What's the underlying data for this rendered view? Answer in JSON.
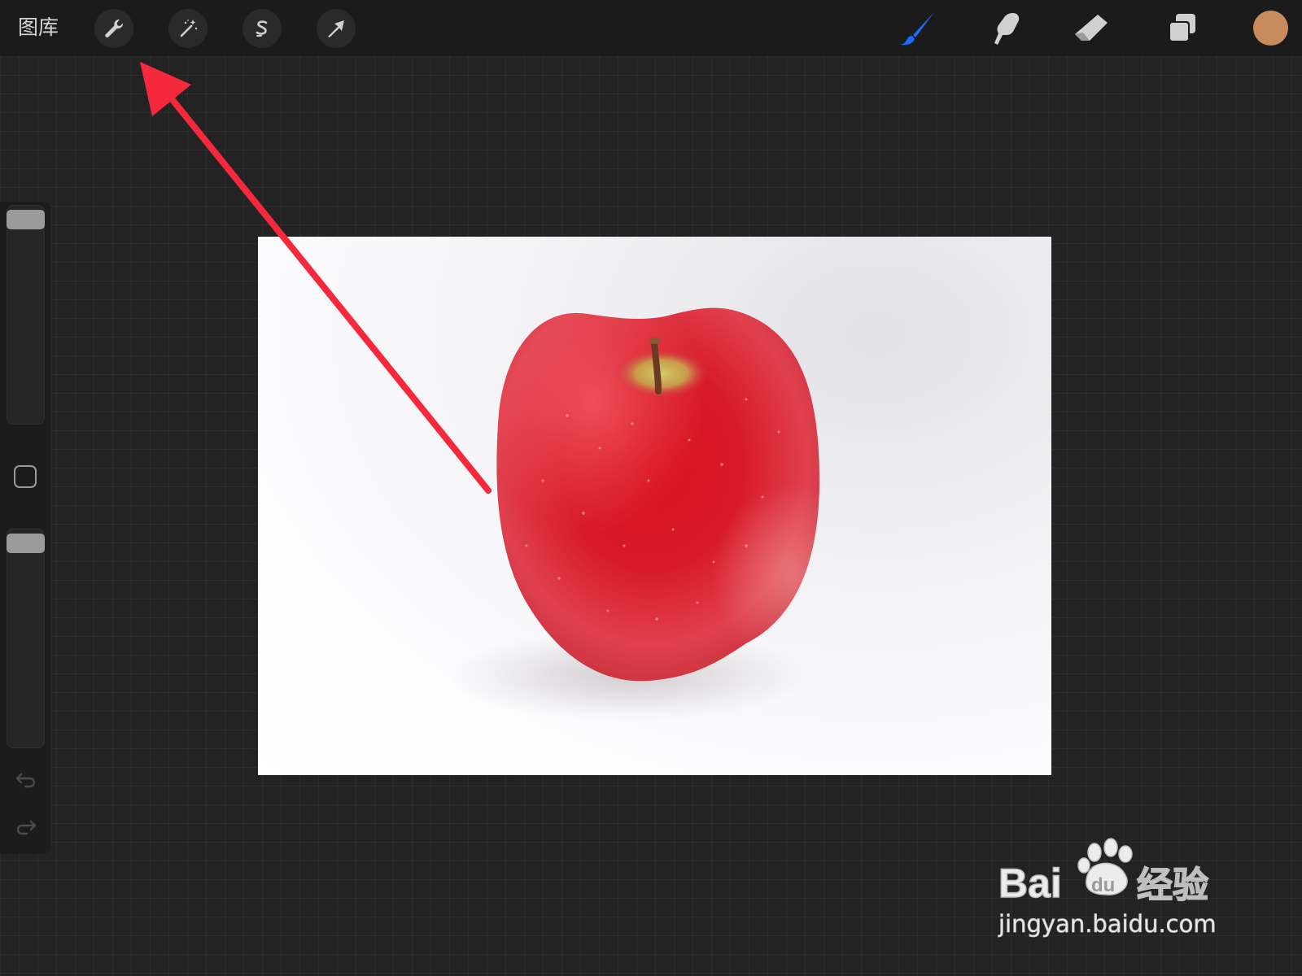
{
  "topbar": {
    "gallery_label": "图库",
    "left_tools": [
      {
        "name": "actions",
        "icon": "wrench-icon"
      },
      {
        "name": "adjustments",
        "icon": "magic-wand-icon"
      },
      {
        "name": "selection",
        "icon": "selection-s-icon"
      },
      {
        "name": "transform",
        "icon": "arrow-cursor-icon"
      }
    ],
    "right_tools": [
      {
        "name": "brush",
        "icon": "brush-icon",
        "active": true
      },
      {
        "name": "smudge",
        "icon": "smudge-finger-icon",
        "active": false
      },
      {
        "name": "eraser",
        "icon": "eraser-icon",
        "active": false
      },
      {
        "name": "layers",
        "icon": "layers-icon",
        "active": false
      }
    ],
    "current_color": "#c88c5c",
    "active_tool_color": "#1e6bff"
  },
  "sidebar": {
    "brush_size_slider": {
      "icon": "size-slider",
      "level": 1.0
    },
    "modify_button_icon": "square-icon",
    "opacity_slider": {
      "icon": "opacity-slider",
      "level": 1.0
    },
    "undo_icon": "undo-arrow-icon",
    "redo_icon": "redo-arrow-icon"
  },
  "canvas": {
    "content": "apple-photo",
    "background_color": "#ffffff"
  },
  "annotation": {
    "color": "#f5283c",
    "icon": "red-arrow-annotation"
  },
  "watermark": {
    "brand": "Bai",
    "brand_du": "du",
    "brand_suffix": "经验",
    "url": "jingyan.baidu.com"
  }
}
